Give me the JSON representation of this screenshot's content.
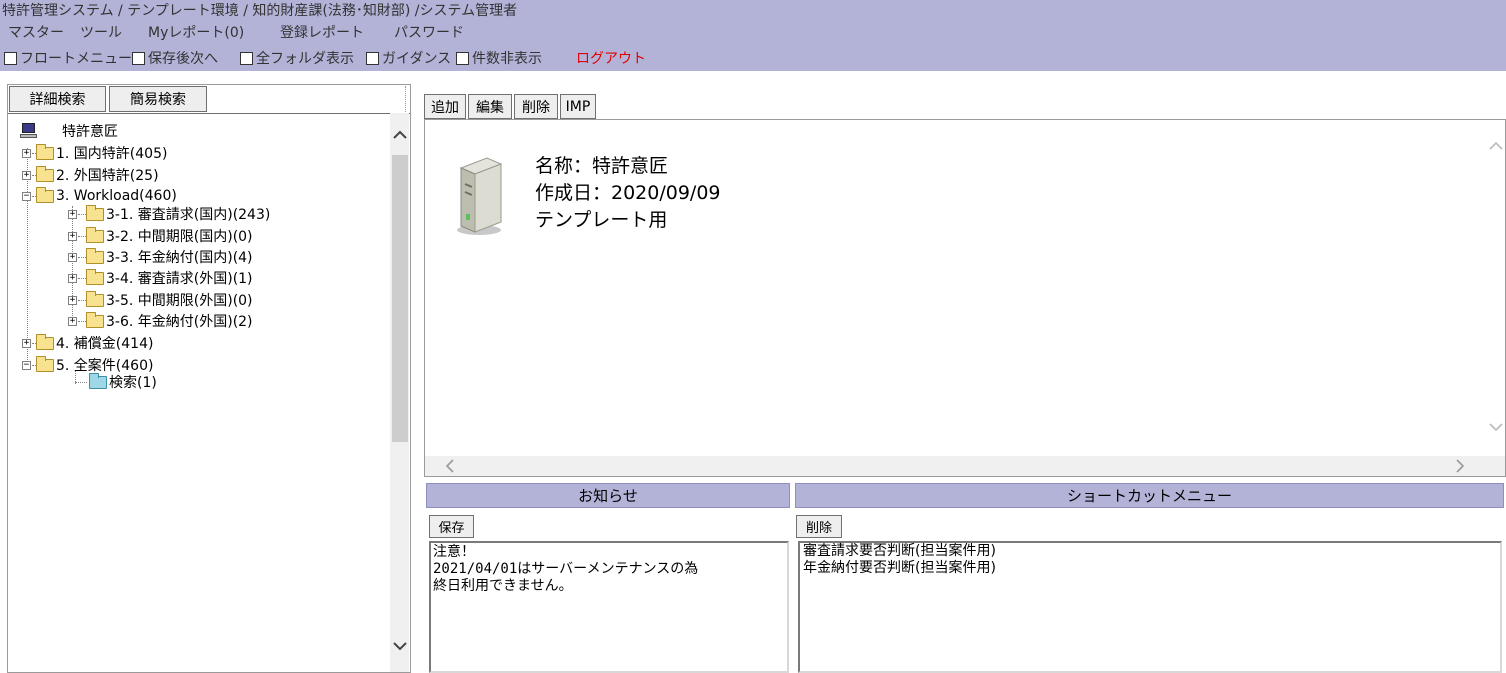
{
  "header": {
    "breadcrumb": "特許管理システム / テンプレート環境 / 知的財産課(法務･知財部) /システム管理者",
    "menu": [
      "マスター",
      "ツール",
      "Myレポート(0)",
      "登録レポート",
      "パスワード"
    ],
    "options": [
      "フロートメニュー",
      "保存後次へ",
      "全フォルダ表示",
      "ガイダンス",
      "件数非表示"
    ],
    "logout": "ログアウト",
    "colors": {
      "header_bg": "#b3b3d8",
      "logout": "#e00000"
    }
  },
  "left_tabs": [
    "詳細検索",
    "簡易検索"
  ],
  "tree": {
    "root": "特許意匠",
    "nodes": [
      {
        "label": "1. 国内特許(405)",
        "expander": "+"
      },
      {
        "label": "2. 外国特許(25)",
        "expander": "+"
      },
      {
        "label": "3. Workload(460)",
        "expander": "−"
      },
      {
        "label": "3-1. 審査請求(国内)(243)",
        "expander": "+"
      },
      {
        "label": "3-2. 中間期限(国内)(0)",
        "expander": "+"
      },
      {
        "label": "3-3. 年金納付(国内)(4)",
        "expander": "+"
      },
      {
        "label": "3-4. 審査請求(外国)(1)",
        "expander": "+"
      },
      {
        "label": "3-5. 中間期限(外国)(0)",
        "expander": "+"
      },
      {
        "label": "3-6. 年金納付(外国)(2)",
        "expander": "+"
      },
      {
        "label": "4. 補償金(414)",
        "expander": "+"
      },
      {
        "label": "5. 全案件(460)",
        "expander": "−"
      },
      {
        "label": "検索(1)",
        "expander": ""
      }
    ]
  },
  "right_tabs": [
    "追加",
    "編集",
    "削除",
    "IMP"
  ],
  "info": {
    "name": "名称：特許意匠",
    "created": "作成日：2020/09/09",
    "note": "テンプレート用"
  },
  "notice": {
    "title": "お知らせ",
    "save_label": "保存",
    "text": "注意！\n2021/04/01はサーバーメンテナンスの為\n終日利用できません。"
  },
  "shortcut": {
    "title": "ショートカットメニュー",
    "delete_label": "削除",
    "items": [
      "審査請求要否判断(担当案件用)",
      "年金納付要否判断(担当案件用)"
    ]
  },
  "icons": {
    "scroll_up": "chevron-up-icon",
    "scroll_down": "chevron-down-icon",
    "scroll_left": "chevron-left-icon",
    "scroll_right": "chevron-right-icon",
    "root": "computer-icon",
    "folder": "folder-icon",
    "search_folder": "search-folder-icon",
    "server": "server-icon"
  }
}
